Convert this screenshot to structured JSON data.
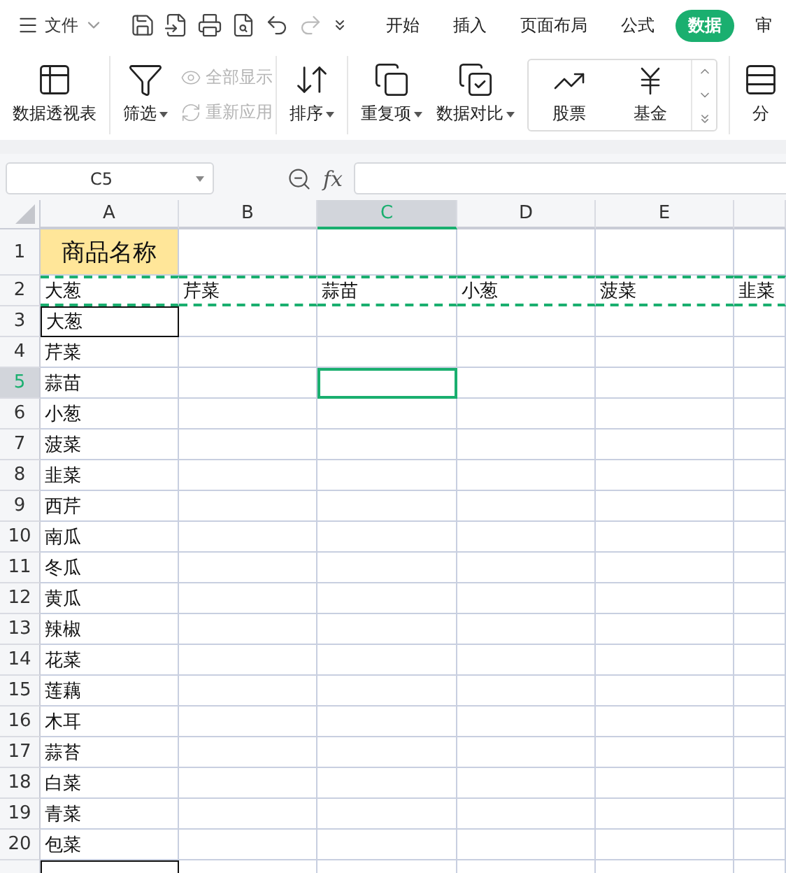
{
  "menu": {
    "label": "文件"
  },
  "tabs": [
    {
      "label": "开始",
      "selected": false
    },
    {
      "label": "插入",
      "selected": false
    },
    {
      "label": "页面布局",
      "selected": false
    },
    {
      "label": "公式",
      "selected": false
    },
    {
      "label": "数据",
      "selected": true
    },
    {
      "label": "审",
      "selected": false
    }
  ],
  "ribbon": [
    {
      "items": [
        {
          "kind": "large",
          "label": "数据透视表",
          "dropdown": false,
          "disabled": false
        }
      ]
    },
    {
      "items": [
        {
          "kind": "large",
          "label": "筛选",
          "dropdown": true,
          "disabled": false
        },
        {
          "kind": "small",
          "label": "全部显示",
          "dropdown": false,
          "disabled": true
        },
        {
          "kind": "small",
          "label": "重新应用",
          "dropdown": false,
          "disabled": true
        }
      ]
    },
    {
      "items": [
        {
          "kind": "large",
          "label": "排序",
          "dropdown": true,
          "disabled": false
        }
      ]
    },
    {
      "items": [
        {
          "kind": "large",
          "label": "重复项",
          "dropdown": true,
          "disabled": false
        },
        {
          "kind": "large",
          "label": "数据对比",
          "dropdown": true,
          "disabled": false
        },
        {
          "kind": "gallery",
          "label": "股票",
          "dropdown": false,
          "disabled": false
        },
        {
          "kind": "gallery",
          "label": "基金",
          "dropdown": false,
          "disabled": false
        }
      ]
    },
    {
      "items": [
        {
          "kind": "large",
          "label": "分",
          "dropdown": false,
          "disabled": false
        }
      ]
    }
  ],
  "formula_bar": {
    "name_box": "C5",
    "fx_label": "fx"
  },
  "sheet": {
    "columns": [
      {
        "label": "A",
        "selected": false
      },
      {
        "label": "B",
        "selected": false
      },
      {
        "label": "C",
        "selected": true
      },
      {
        "label": "D",
        "selected": false
      },
      {
        "label": "E",
        "selected": false
      }
    ],
    "rows": [
      {
        "header": "1",
        "selected": false,
        "copied": false,
        "bordered": false,
        "kind": "title",
        "cells": [
          "商品名称"
        ]
      },
      {
        "header": "2",
        "selected": false,
        "copied": true,
        "bordered": false,
        "kind": "plain",
        "cells": [
          "大葱",
          "芹菜",
          "蒜苗",
          "小葱",
          "菠菜",
          "韭菜"
        ]
      },
      {
        "header": "3",
        "selected": false,
        "copied": false,
        "bordered": true,
        "kind": "plain",
        "cells": [
          "大葱"
        ]
      },
      {
        "header": "4",
        "selected": false,
        "copied": false,
        "bordered": false,
        "kind": "plain",
        "cells": [
          "芹菜"
        ]
      },
      {
        "header": "5",
        "selected": true,
        "copied": false,
        "bordered": false,
        "kind": "plain",
        "cells": [
          "蒜苗"
        ]
      },
      {
        "header": "6",
        "selected": false,
        "copied": false,
        "bordered": false,
        "kind": "plain",
        "cells": [
          "小葱"
        ]
      },
      {
        "header": "7",
        "selected": false,
        "copied": false,
        "bordered": false,
        "kind": "plain",
        "cells": [
          "菠菜"
        ]
      },
      {
        "header": "8",
        "selected": false,
        "copied": false,
        "bordered": false,
        "kind": "plain",
        "cells": [
          "韭菜"
        ]
      },
      {
        "header": "9",
        "selected": false,
        "copied": false,
        "bordered": false,
        "kind": "plain",
        "cells": [
          "西芹"
        ]
      },
      {
        "header": "10",
        "selected": false,
        "copied": false,
        "bordered": false,
        "kind": "plain",
        "cells": [
          "南瓜"
        ]
      },
      {
        "header": "11",
        "selected": false,
        "copied": false,
        "bordered": false,
        "kind": "plain",
        "cells": [
          "冬瓜"
        ]
      },
      {
        "header": "12",
        "selected": false,
        "copied": false,
        "bordered": false,
        "kind": "plain",
        "cells": [
          "黄瓜"
        ]
      },
      {
        "header": "13",
        "selected": false,
        "copied": false,
        "bordered": false,
        "kind": "plain",
        "cells": [
          "辣椒"
        ]
      },
      {
        "header": "14",
        "selected": false,
        "copied": false,
        "bordered": false,
        "kind": "plain",
        "cells": [
          "花菜"
        ]
      },
      {
        "header": "15",
        "selected": false,
        "copied": false,
        "bordered": false,
        "kind": "plain",
        "cells": [
          "莲藕"
        ]
      },
      {
        "header": "16",
        "selected": false,
        "copied": false,
        "bordered": false,
        "kind": "plain",
        "cells": [
          "木耳"
        ]
      },
      {
        "header": "17",
        "selected": false,
        "copied": false,
        "bordered": false,
        "kind": "plain",
        "cells": [
          "蒜苔"
        ]
      },
      {
        "header": "18",
        "selected": false,
        "copied": false,
        "bordered": false,
        "kind": "plain",
        "cells": [
          "白菜"
        ]
      },
      {
        "header": "19",
        "selected": false,
        "copied": false,
        "bordered": false,
        "kind": "plain",
        "cells": [
          "青菜"
        ]
      },
      {
        "header": "20",
        "selected": false,
        "copied": false,
        "bordered": false,
        "kind": "plain",
        "cells": [
          "包菜"
        ]
      },
      {
        "selected": false,
        "copied": false,
        "bordered": true,
        "kind": "plain",
        "cells": []
      }
    ]
  }
}
